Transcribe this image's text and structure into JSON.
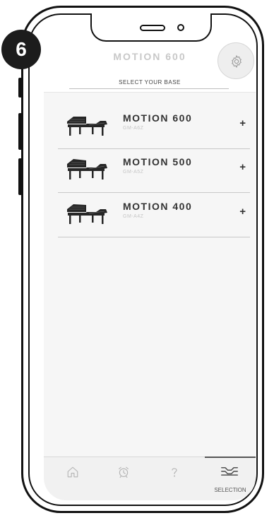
{
  "step_badge": "6",
  "header": {
    "title": "MOTION 600",
    "subtitle": "SELECT YOUR BASE",
    "settings_icon": "gear-icon"
  },
  "bases": [
    {
      "name": "MOTION 600",
      "code": "GM-A6Z",
      "action": "+",
      "icon": "adjustable-bed-icon"
    },
    {
      "name": "MOTION 500",
      "code": "GM-A5Z",
      "action": "+",
      "icon": "adjustable-bed-icon"
    },
    {
      "name": "MOTION 400",
      "code": "GM-A4Z",
      "action": "+",
      "icon": "adjustable-bed-icon"
    }
  ],
  "tabbar": {
    "tabs": [
      {
        "icon": "home-icon"
      },
      {
        "icon": "alarm-clock-icon"
      },
      {
        "icon": "question-mark-icon"
      },
      {
        "icon": "bed-position-icon",
        "label": "SELECTION",
        "active": true
      }
    ]
  },
  "colors": {
    "frame": "#111111",
    "content_bg": "#f6f6f6",
    "title_gray": "#c8c8c8",
    "text_dark": "#333333"
  }
}
